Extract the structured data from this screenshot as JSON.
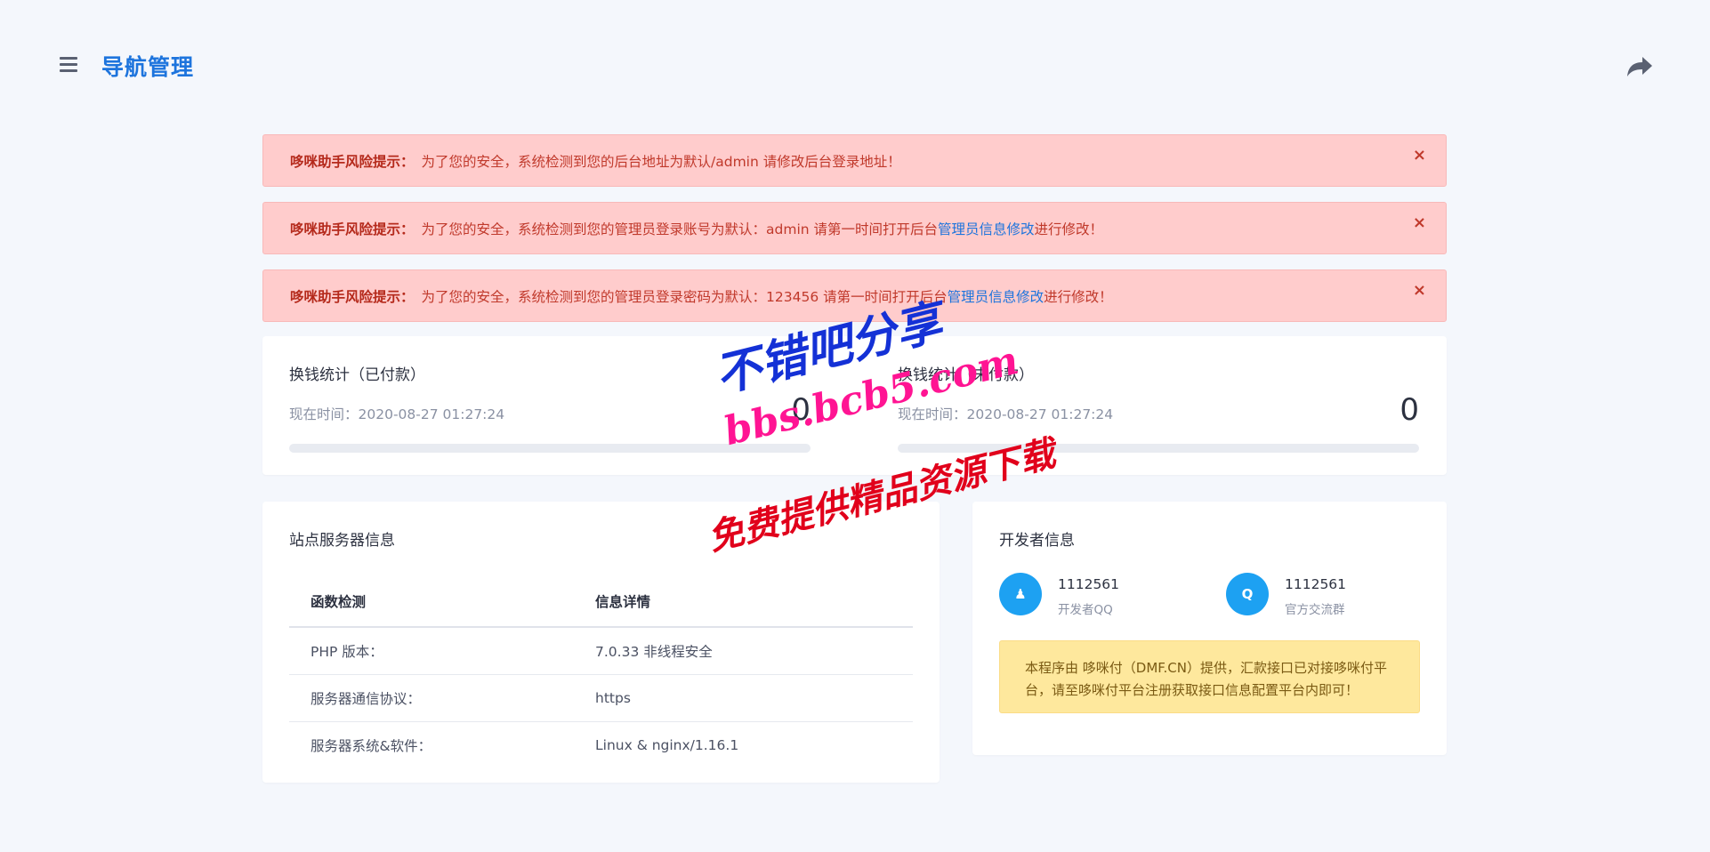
{
  "header": {
    "title": "导航管理",
    "menu_icon": "hamburger-icon",
    "share_icon": "share-arrow-icon"
  },
  "alerts": [
    {
      "label": "哆咪助手风险提示：",
      "message": "为了您的安全，系统检测到您的后台地址为默认/admin 请修改后台登录地址！",
      "link": "",
      "suffix": ""
    },
    {
      "label": "哆咪助手风险提示：",
      "message": "为了您的安全，系统检测到您的管理员登录账号为默认：admin 请第一时间打开后台",
      "link": "管理员信息修改",
      "suffix": "进行修改！"
    },
    {
      "label": "哆咪助手风险提示：",
      "message": "为了您的安全，系统检测到您的管理员登录密码为默认：123456 请第一时间打开后台",
      "link": "管理员信息修改",
      "suffix": "进行修改！"
    }
  ],
  "alert_close_glyph": "×",
  "stats": [
    {
      "title": "换钱统计（已付款）",
      "time": "现在时间：2020-08-27 01:27:24",
      "value": "0",
      "progress": 0
    },
    {
      "title": "换钱统计（未付款）",
      "time": "现在时间：2020-08-27 01:27:24",
      "value": "0",
      "progress": 0
    }
  ],
  "server_info": {
    "title": "站点服务器信息",
    "headers": [
      "函数检测",
      "信息详情"
    ],
    "rows": [
      [
        "PHP 版本：",
        "7.0.33 非线程安全"
      ],
      [
        "服务器通信协议：",
        "https"
      ],
      [
        "服务器系统&软件：",
        "Linux & nginx/1.16.1"
      ]
    ]
  },
  "developer": {
    "title": "开发者信息",
    "items": [
      {
        "icon": "qq-icon",
        "glyph": "♟",
        "number": "1112561",
        "caption": "开发者QQ"
      },
      {
        "icon": "qq-group-icon",
        "glyph": "Q",
        "number": "1112561",
        "caption": "官方交流群"
      }
    ],
    "notice": "本程序由 哆咪付（DMF.CN）提供，汇款接口已对接哆咪付平台，请至哆咪付平台注册获取接口信息配置平台内即可！"
  },
  "watermark": {
    "line1": "不错吧分享",
    "line2": "bbs.bcb5.com",
    "line3": "免费提供精品资源下载"
  },
  "colors": {
    "accent": "#1d74dd",
    "alert_bg": "#ffcccc",
    "alert_text": "#c0392b",
    "notice_bg": "#fee89d",
    "icon_blue": "#1da1f2"
  }
}
